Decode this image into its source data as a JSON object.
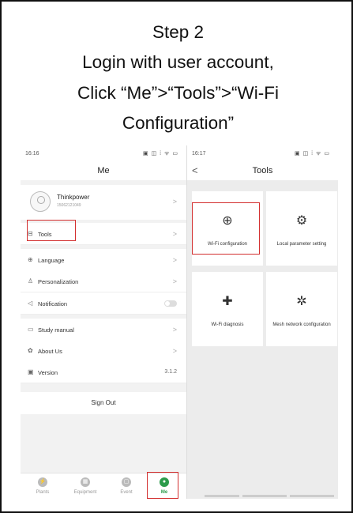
{
  "instructions": {
    "line1": "Step 2",
    "line2": "Login with user account,",
    "line3": "Click “Me”>“Tools”>“Wi-Fi",
    "line4": "Configuration”"
  },
  "left_screen": {
    "status_time": "16:16",
    "status_icons": "▣ ◫ ⁞ ᯤ ▭",
    "title": "Me",
    "profile": {
      "name": "Thinkpower",
      "id": "15062121049"
    },
    "rows": [
      {
        "label": "Tools",
        "icon": "toolbox-icon",
        "glyph": "⊟",
        "chev": ">"
      },
      {
        "label": "Language",
        "icon": "globe-icon",
        "glyph": "⊕",
        "chev": ">"
      },
      {
        "label": "Personalization",
        "icon": "user-settings-icon",
        "glyph": "♙",
        "chev": ">"
      },
      {
        "label": "Notification",
        "icon": "speaker-icon",
        "glyph": "◁",
        "chev": ""
      },
      {
        "label": "Study manual",
        "icon": "book-icon",
        "glyph": "▭",
        "chev": ">"
      },
      {
        "label": "About Us",
        "icon": "info-icon",
        "glyph": "✿",
        "chev": ">"
      },
      {
        "label": "Version",
        "icon": "version-icon",
        "glyph": "▣",
        "chev": "",
        "value": "3.1.2"
      }
    ],
    "sign_out": "Sign Out",
    "tabs": [
      {
        "label": "Plants",
        "glyph": "⚡"
      },
      {
        "label": "Equipment",
        "glyph": "▦"
      },
      {
        "label": "Event",
        "glyph": "▢"
      },
      {
        "label": "Me",
        "glyph": "●"
      }
    ],
    "chevron": ">"
  },
  "right_screen": {
    "status_time": "16:17",
    "status_icons": "▣ ◫ ⁞ ᯤ ▭",
    "title": "Tools",
    "back": "<",
    "tiles": [
      {
        "label": "Wi-Fi configuration",
        "icon": "globe-gear-icon",
        "glyph": "⊕"
      },
      {
        "label": "Local parameter setting",
        "icon": "folder-gear-icon",
        "glyph": "⚙"
      },
      {
        "label": "Wi-Fi diagnosis",
        "icon": "medical-kit-icon",
        "glyph": "✚"
      },
      {
        "label": "Mesh network configuration",
        "icon": "mesh-network-icon",
        "glyph": "✲"
      }
    ]
  },
  "colors": {
    "highlight": "#d32f2f",
    "accent_green": "#2c9b4b"
  }
}
